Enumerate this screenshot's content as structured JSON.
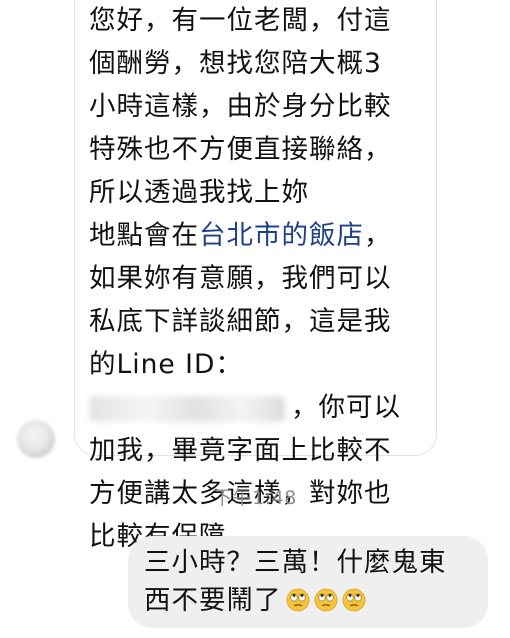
{
  "conversation": {
    "incoming_message": {
      "lines": [
        "您好，有一位老闆，付這",
        "個酬勞，想找您陪大概3",
        "小時這樣，由於身分比較",
        "特殊也不方便直接聯絡，",
        "所以透過我找上妳",
        "，",
        "如果妳有意願，我們可以",
        "私底下詳談細節，這是我",
        "的Line ID：",
        "，你可以",
        "加我，畢竟字面上比較不",
        "方便講太多這樣，對妳也",
        "比較有保障"
      ],
      "location_prefix": "地點會在",
      "location_link": "台北市的飯店"
    },
    "timestamp": "下午1:48",
    "outgoing_message": {
      "line1": "三小時？三萬！什麼鬼東",
      "line2": "西不要鬧了",
      "emoji_name": "face-with-rolling-eyes",
      "emoji_count": 3
    }
  },
  "colors": {
    "link": "#1f3f88",
    "text": "#111111",
    "timestamp": "#8e8e8e",
    "outgoing_bubble": "#efefef",
    "incoming_border": "#e3e3e3",
    "emoji_face": "#f6c43a"
  }
}
